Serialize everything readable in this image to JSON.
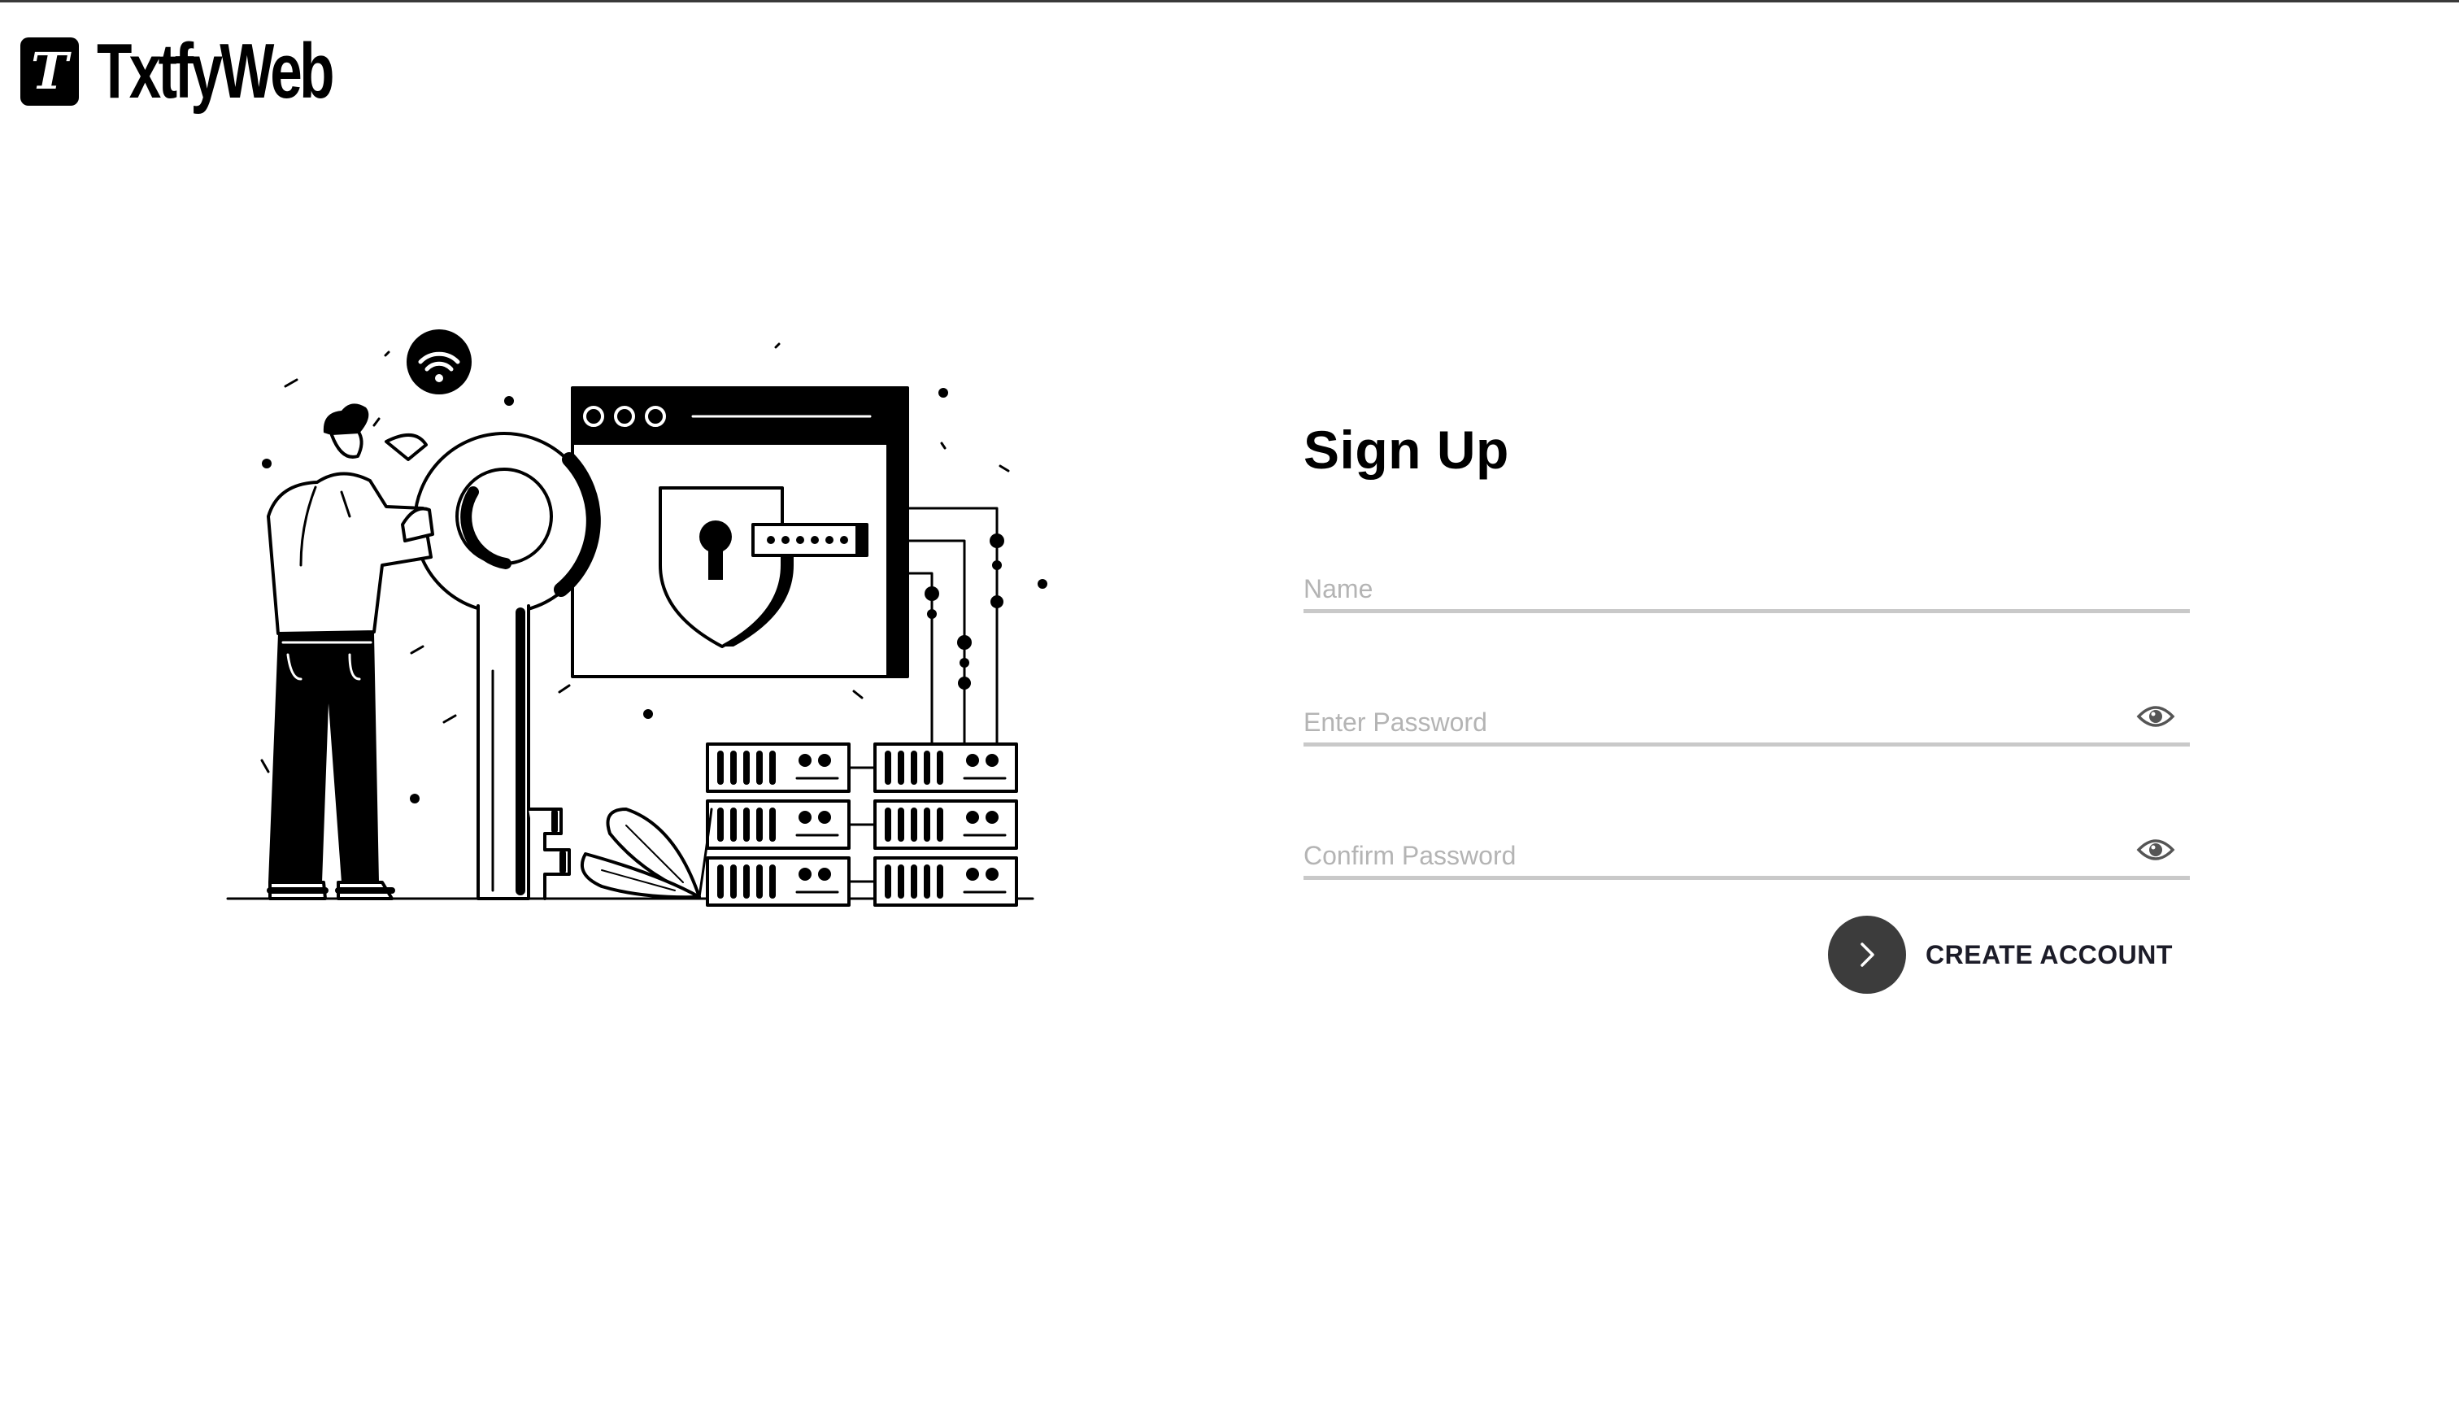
{
  "brand": {
    "logo_letter": "T",
    "name": "TxtfyWeb"
  },
  "form": {
    "title": "Sign Up",
    "name_placeholder": "Name",
    "password_placeholder": "Enter Password",
    "confirm_placeholder": "Confirm Password",
    "submit_label": "CREATE ACCOUNT"
  },
  "colors": {
    "background": "#ffffff",
    "text": "#000000",
    "input_underline": "#c9c9c9",
    "placeholder": "#b4b4b4",
    "submit_circle": "#3c3c3c"
  },
  "icons": {
    "logo": "t-logo-icon",
    "password_toggle": "eye-icon",
    "submit": "chevron-right-icon"
  }
}
